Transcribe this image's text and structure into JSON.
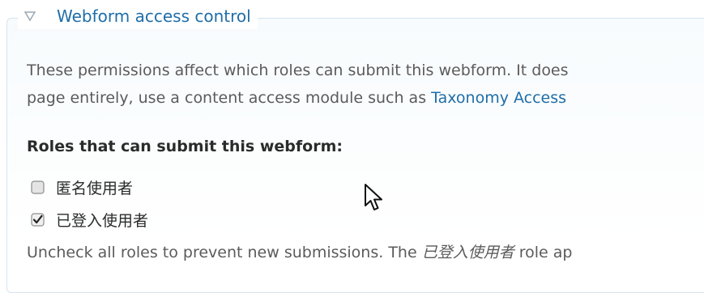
{
  "fieldset": {
    "legend": "Webform access control",
    "collapse_icon": "triangle-down-icon"
  },
  "description": {
    "line1": "These permissions affect which roles can submit this webform. It does",
    "line2_prefix": "page entirely, use a content access module such as ",
    "link_text": "Taxonomy Access"
  },
  "roles": {
    "label": "Roles that can submit this webform:",
    "options": [
      {
        "label": "匿名使用者",
        "checked": false
      },
      {
        "label": "已登入使用者",
        "checked": true
      }
    ]
  },
  "help": {
    "prefix": "Uncheck all roles to prevent new submissions. The ",
    "role_name": "已登入使用者",
    "suffix": " role ap"
  },
  "cursor_icon": "mouse-pointer-icon",
  "colors": {
    "accent": "#1f6ea8",
    "border": "#d7e3ee",
    "text": "#3b3b3b",
    "muted": "#5b5b5b"
  }
}
